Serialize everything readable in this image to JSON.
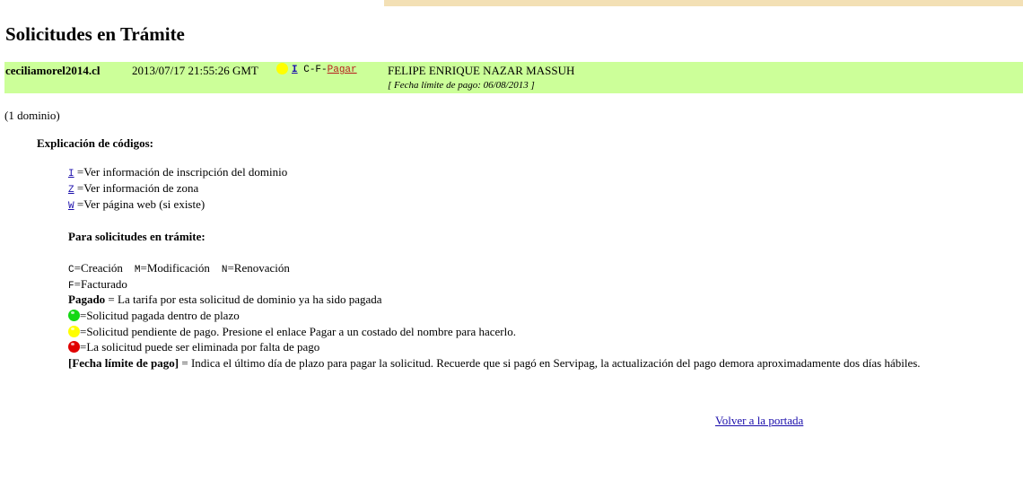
{
  "page": {
    "title": "Solicitudes en Trámite"
  },
  "request": {
    "domain": "ceciliamorel2014.cl",
    "datetime": "2013/07/17 21:55:26 GMT",
    "status_color": "#ffff00",
    "code_i": "I",
    "code_cf": "C-F-",
    "pay_label": "Pagar",
    "owner": "FELIPE ENRIQUE NAZAR MASSUH",
    "deadline": "[ Fecha límite de pago: 06/08/2013 ]"
  },
  "count_text": "(1 dominio)",
  "legend": {
    "heading": "Explicación de códigos:",
    "i_code": "I",
    "i_text": "=Ver información de inscripción del dominio",
    "z_code": "Z",
    "z_text": "=Ver información de zona",
    "w_code": "W",
    "w_text": "=Ver página web (si existe)",
    "pending_heading": "Para solicitudes en trámite:",
    "c_code": "C",
    "c_text": "=Creación",
    "m_code": "M",
    "m_text": "=Modificación",
    "n_code": "N",
    "n_text": "=Renovación",
    "f_code": "F",
    "f_text": "=Facturado",
    "paid_label": "Pagado",
    "paid_text": " = La tarifa por esta solicitud de dominio ya ha sido pagada",
    "green_text": "=Solicitud pagada dentro de plazo",
    "yellow_text": "=Solicitud pendiente de pago. Presione el enlace Pagar a un costado del nombre para hacerlo.",
    "red_text": "=La solicitud puede ser eliminada por falta de pago",
    "deadline_label": "[Fecha límite de pago]",
    "deadline_text": " = Indica el último día de plazo para pagar la solicitud. Recuerde que si pagó en Servipag, la actualización del pago demora aproximadamente dos días hábiles."
  },
  "footer": {
    "back_link": "Volver a la portada"
  }
}
